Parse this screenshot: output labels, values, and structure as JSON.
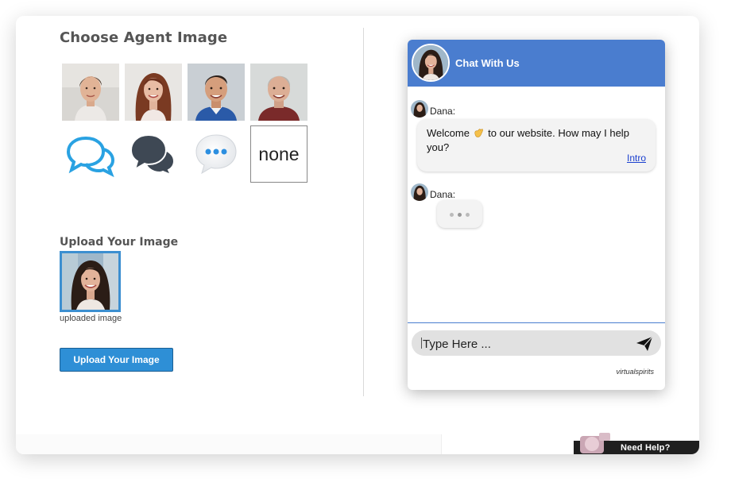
{
  "picker": {
    "title": "Choose Agent Image",
    "options": [
      {
        "kind": "photo",
        "name": "agent-photo-1"
      },
      {
        "kind": "photo",
        "name": "agent-photo-2"
      },
      {
        "kind": "photo",
        "name": "agent-photo-3"
      },
      {
        "kind": "photo",
        "name": "agent-photo-4"
      },
      {
        "kind": "icon",
        "name": "chat-bubbles-outline-icon",
        "color": "#2aa2e2"
      },
      {
        "kind": "icon",
        "name": "chat-bubbles-filled-icon",
        "color": "#3e4854"
      },
      {
        "kind": "icon",
        "name": "typing-bubble-icon",
        "color": "#2c8fe0"
      },
      {
        "kind": "text",
        "label": "none"
      }
    ]
  },
  "upload": {
    "title": "Upload Your Image",
    "caption": "uploaded image",
    "button_label": "Upload Your Image"
  },
  "chat": {
    "header_title": "Chat With Us",
    "header_color": "#4a7dcf",
    "messages": [
      {
        "sender": "Dana:",
        "text_before": "Welcome ",
        "emoji": "waving-hand",
        "text_after": " to our website. How may I help you?",
        "link": "Intro"
      },
      {
        "sender": "Dana:",
        "typing": true
      }
    ],
    "input_placeholder": "Type Here ...",
    "brand": "virtualspirits"
  },
  "help_tab": {
    "label": "Need Help?"
  },
  "colors": {
    "accent": "#2e8fd6",
    "title_text": "#555555"
  }
}
